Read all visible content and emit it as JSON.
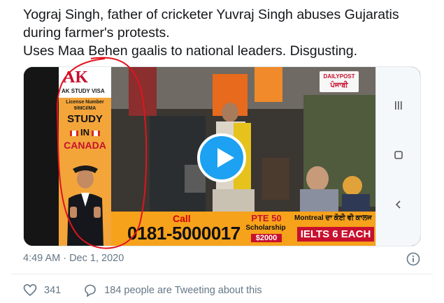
{
  "tweet": {
    "lines": [
      "Yograj Singh, father of cricketer Yuvraj Singh abuses Gujaratis",
      "during farmer's protests.",
      "Uses Maa Behen gaalis to national leaders. Disgusting."
    ]
  },
  "video": {
    "play_icon": "play-icon",
    "ad": {
      "logo": "AK",
      "subtitle": "AK STUDY VISA",
      "license": "License Number\n9/MCI/MA",
      "study": "STUDY",
      "in": "IN",
      "country": "CANADA"
    },
    "banner": {
      "call": "Call",
      "phone": "0181-5000017",
      "pte": "PTE 50",
      "scholarship": "Scholarship",
      "amount": "$2000",
      "montreal": "Montreal ਦਾ ਕੋਈ ਵੀ ਕਾਲਜ",
      "ielts": "IELTS 6 EACH"
    },
    "watermark": {
      "brand": "DAILYPOST",
      "script": "ਪੰਜਾਬੀ"
    },
    "side_controls": [
      "menu-icon",
      "home-icon",
      "back-icon"
    ]
  },
  "meta": {
    "timestamp": "4:49 AM · Dec 1, 2020",
    "info_icon": "info-icon"
  },
  "actions": {
    "like_icon": "heart-icon",
    "like_count": "341",
    "reply_icon": "chat-bubble-icon",
    "tweeting_text": "184 people are Tweeting about this"
  },
  "colors": {
    "accent": "#1da1f2",
    "muted": "#657786",
    "annotation": "#e0141e"
  }
}
